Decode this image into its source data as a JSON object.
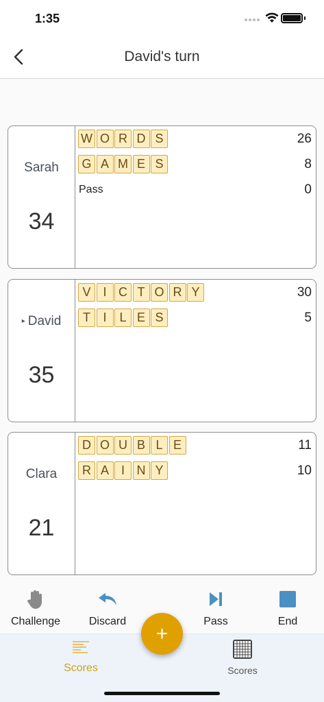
{
  "status": {
    "time": "1:35"
  },
  "nav": {
    "title": "David's turn"
  },
  "players": [
    {
      "name": "Sarah",
      "total": "34",
      "current": false,
      "plays": [
        {
          "word": "WORDS",
          "score": "26"
        },
        {
          "word": "GAMES",
          "score": "8"
        },
        {
          "word": "",
          "pass_label": "Pass",
          "score": "0"
        }
      ]
    },
    {
      "name": "David",
      "total": "35",
      "current": true,
      "plays": [
        {
          "word": "VICTORY",
          "score": "30"
        },
        {
          "word": "TILES",
          "score": "5"
        }
      ]
    },
    {
      "name": "Clara",
      "total": "21",
      "current": false,
      "plays": [
        {
          "word": "DOUBLE",
          "score": "11"
        },
        {
          "word": "RAINY",
          "score": "10"
        }
      ]
    }
  ],
  "actions": {
    "challenge": "Challenge",
    "discard": "Discard",
    "pass": "Pass",
    "end": "End"
  },
  "fab": {
    "label": "+"
  },
  "tabs": {
    "scores_active": "Scores",
    "scores_grid": "Scores"
  },
  "colors": {
    "accent": "#e0a000",
    "tile_bg": "#fdeec0",
    "tile_border": "#d4a741",
    "action_blue": "#4a90c2",
    "tab_active": "#caa31c"
  }
}
